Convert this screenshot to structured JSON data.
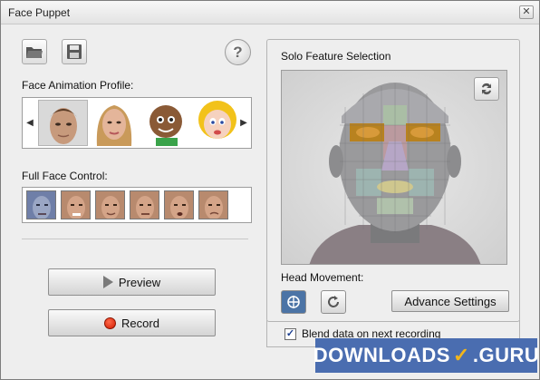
{
  "window": {
    "title": "Face Puppet",
    "close_glyph": "✕"
  },
  "toolbar": {
    "open_icon": "folder-open-icon",
    "save_icon": "save-disk-icon",
    "help_label": "?"
  },
  "profile": {
    "label": "Face Animation Profile:",
    "left_arrow": "◀",
    "right_arrow": "▶",
    "items": [
      {
        "name": "male-realistic",
        "selected": true
      },
      {
        "name": "female-realistic",
        "selected": false
      },
      {
        "name": "boy-cartoon",
        "selected": false
      },
      {
        "name": "girl-cartoon",
        "selected": false
      }
    ]
  },
  "full_face": {
    "label": "Full Face Control:",
    "items": [
      "face-1",
      "face-2",
      "face-3",
      "face-4",
      "face-5",
      "face-6"
    ]
  },
  "actions": {
    "preview_label": "Preview",
    "record_label": "Record"
  },
  "solo": {
    "title": "Solo Feature Selection",
    "swap_icon": "swap-arrows-icon",
    "head_movement_label": "Head Movement:",
    "advance_settings_label": "Advance Settings",
    "blend_label": "Blend data on next recording",
    "blend_checked": true,
    "blend_check_glyph": "✓"
  },
  "watermark": {
    "text_left": "DOWNLOADS",
    "check_glyph": "✓",
    "text_right": ".GURU"
  },
  "colors": {
    "accent_record": "#d21a00",
    "watermark_bg": "#4a6db0",
    "watermark_check": "#f2b51b",
    "active_tool": "#4c74a6"
  }
}
